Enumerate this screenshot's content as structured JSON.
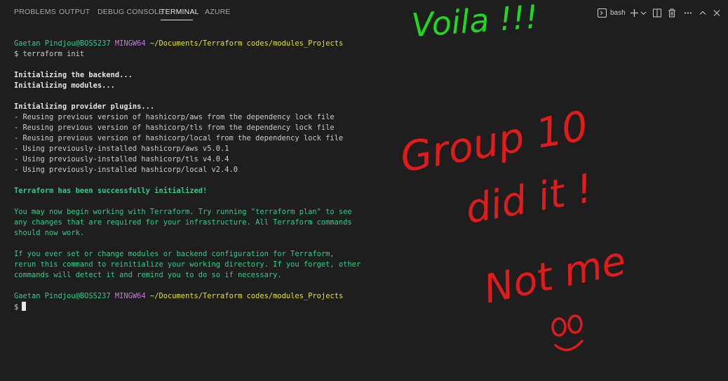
{
  "tabs": [
    {
      "label": "PROBLEMS"
    },
    {
      "label": "OUTPUT"
    },
    {
      "label": "DEBUG CONSOLE"
    },
    {
      "label": "TERMINAL"
    },
    {
      "label": "AZURE"
    }
  ],
  "toolbar": {
    "shell_label": "bash",
    "icons": [
      "terminal-icon",
      "plus-icon",
      "chevron-down-icon",
      "split-icon",
      "trash-icon",
      "more-icon",
      "chevron-up-icon",
      "close-icon"
    ]
  },
  "terminal": {
    "prompt_user": "Gaetan Pindjou@BOSS237",
    "prompt_env": "MINGW64",
    "prompt_path": "~/Documents/Terraform codes/modules_Projects",
    "command": "$ terraform init",
    "init_backend": "Initializing the backend...",
    "init_modules": "Initializing modules...",
    "init_plugins": "Initializing provider plugins...",
    "plugin_lines": [
      "- Reusing previous version of hashicorp/aws from the dependency lock file",
      "- Reusing previous version of hashicorp/tls from the dependency lock file",
      "- Reusing previous version of hashicorp/local from the dependency lock file",
      "- Using previously-installed hashicorp/aws v5.0.1",
      "- Using previously-installed hashicorp/tls v4.0.4",
      "- Using previously-installed hashicorp/local v2.4.0"
    ],
    "success": "Terraform has been successfully initialized!",
    "para1": [
      "You may now begin working with Terraform. Try running \"terraform plan\" to see",
      "any changes that are required for your infrastructure. All Terraform commands",
      "should now work."
    ],
    "para2": [
      "If you ever set or change modules or backend configuration for Terraform,",
      "rerun this command to reinitialize your working directory. If you forget, other",
      "commands will detect it and remind you to do so if necessary."
    ],
    "final_prompt": "$"
  },
  "annotations": {
    "voila": "Voila !!!",
    "group_line1": "Group 10",
    "group_line2": "did it !",
    "not_me": "Not me",
    "face": "OO",
    "colors": {
      "green": "#1fd81f",
      "red": "#e01b1b"
    }
  }
}
